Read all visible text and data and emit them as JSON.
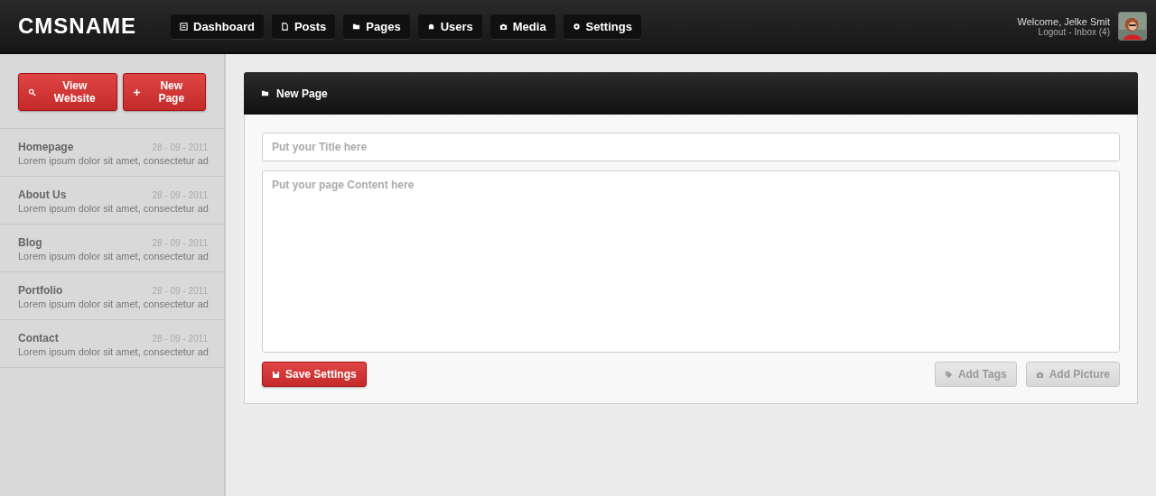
{
  "logo": "CMSNAME",
  "nav": [
    {
      "label": "Dashboard"
    },
    {
      "label": "Posts"
    },
    {
      "label": "Pages"
    },
    {
      "label": "Users"
    },
    {
      "label": "Media"
    },
    {
      "label": "Settings"
    }
  ],
  "user": {
    "welcome": "Welcome, Jelke Smit",
    "logout": "Logout",
    "separator": "-",
    "inbox": "Inbox (4)"
  },
  "sidebar": {
    "buttons": [
      "View Website",
      "New Page"
    ],
    "items": [
      {
        "title": "Homepage",
        "date": "28 - 09 - 2011",
        "excerpt": "Lorem ipsum dolor sit amet, consectetur ad"
      },
      {
        "title": "About Us",
        "date": "28 - 09 - 2011",
        "excerpt": "Lorem ipsum dolor sit amet, consectetur ad"
      },
      {
        "title": "Blog",
        "date": "28 - 09 - 2011",
        "excerpt": "Lorem ipsum dolor sit amet, consectetur ad"
      },
      {
        "title": "Portfolio",
        "date": "28 - 09 - 2011",
        "excerpt": "Lorem ipsum dolor sit amet, consectetur ad"
      },
      {
        "title": "Contact",
        "date": "28 - 09 - 2011",
        "excerpt": "Lorem ipsum dolor sit amet, consectetur ad"
      }
    ]
  },
  "panel": {
    "title": "New Page",
    "title_field": {
      "placeholder": "Put your Title here"
    },
    "content_field": {
      "placeholder": "Put your page Content here"
    },
    "save_button": "Save Settings",
    "extra_buttons": [
      "Add Tags",
      "Add Picture"
    ]
  }
}
